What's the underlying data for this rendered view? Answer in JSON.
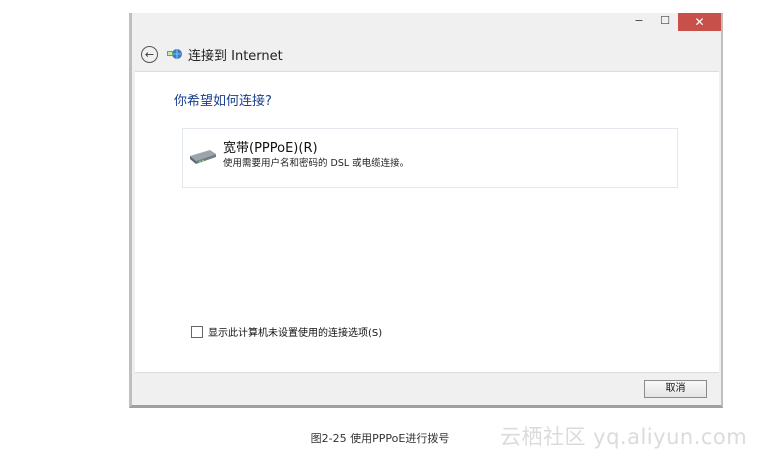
{
  "window": {
    "min_glyph": "−",
    "max_glyph": "☐",
    "close_glyph": "✕",
    "colors": {
      "close_bg": "#c7504a",
      "question_text": "#1a3e8c"
    }
  },
  "header": {
    "back_glyph": "←",
    "icon": "network-globe-icon",
    "title": "连接到 Internet"
  },
  "content": {
    "question": "你希望如何连接?",
    "option": {
      "icon": "modem-icon",
      "title": "宽带(PPPoE)(R)",
      "description": "使用需要用户名和密码的 DSL 或电缆连接。"
    },
    "checkbox_label": "显示此计算机未设置使用的连接选项(S)"
  },
  "footer": {
    "cancel_label": "取消"
  },
  "caption": "图2-25    使用PPPoE进行拨号",
  "watermark": "云栖社区 yq.aliyun.com"
}
